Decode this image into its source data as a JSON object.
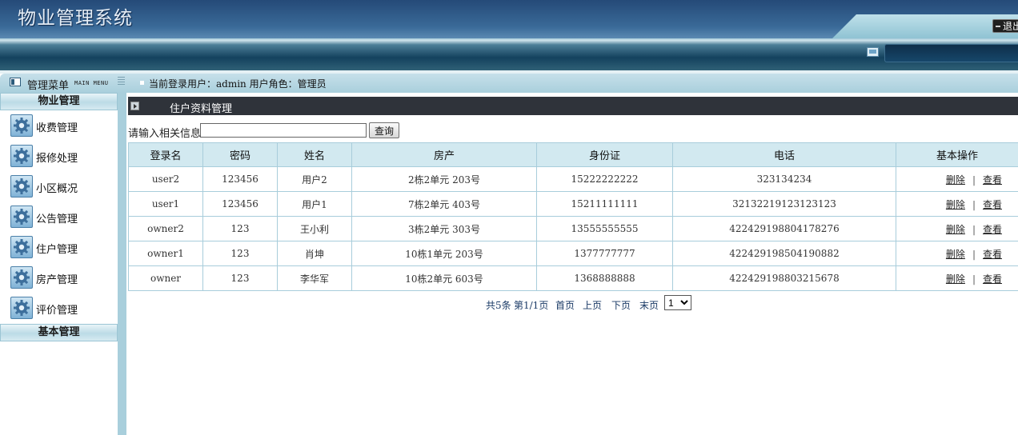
{
  "header": {
    "app_title": "物业管理系统",
    "logout_label": "退出"
  },
  "sidebar": {
    "title": "管理菜单",
    "subtitle": "MAIN MENU",
    "section1": "物业管理",
    "items": [
      {
        "label": "收费管理",
        "icon": "gear-icon"
      },
      {
        "label": "报修处理",
        "icon": "gear-icon"
      },
      {
        "label": "小区概况",
        "icon": "gear-icon"
      },
      {
        "label": "公告管理",
        "icon": "gear-icon"
      },
      {
        "label": "住户管理",
        "icon": "gear-icon"
      },
      {
        "label": "房产管理",
        "icon": "gear-icon"
      },
      {
        "label": "评价管理",
        "icon": "gear-icon"
      }
    ],
    "section2": "基本管理"
  },
  "userbar": {
    "text": "当前登录用户：admin 用户角色：管理员"
  },
  "panel": {
    "title": "住户资料管理"
  },
  "search": {
    "label": "请输入相关信息:",
    "value": "",
    "button": "查询"
  },
  "table": {
    "headers": [
      "登录名",
      "密码",
      "姓名",
      "房产",
      "身份证",
      "电话",
      "基本操作"
    ],
    "rows": [
      [
        "user2",
        "123456",
        "用户2",
        "2栋2单元  203号",
        "15222222222",
        "323134234"
      ],
      [
        "user1",
        "123456",
        "用户1",
        "7栋2单元  403号",
        "15211111111",
        "32132219123123123"
      ],
      [
        "owner2",
        "123",
        "王小利",
        "3栋2单元  303号",
        "13555555555",
        "422429198804178276"
      ],
      [
        "owner1",
        "123",
        "肖坤",
        "10栋1单元  203号",
        "1377777777",
        "422429198504190882"
      ],
      [
        "owner",
        "123",
        "李华军",
        "10栋2单元  603号",
        "1368888888",
        "422429198803215678"
      ]
    ],
    "actions": {
      "delete": "删除",
      "separator": "|",
      "view": "查看"
    }
  },
  "pager": {
    "total": "共5条",
    "page_info": "第1/1页",
    "first": "首页",
    "prev": "上页",
    "next": "下页",
    "last": "末页",
    "selected_page": "1"
  },
  "colors": {
    "header_bg": "#2b5584",
    "sidebar_bg": "#a9cfdc",
    "table_header_bg": "#d2e9f0",
    "panel_head_bg": "#2f333a"
  }
}
